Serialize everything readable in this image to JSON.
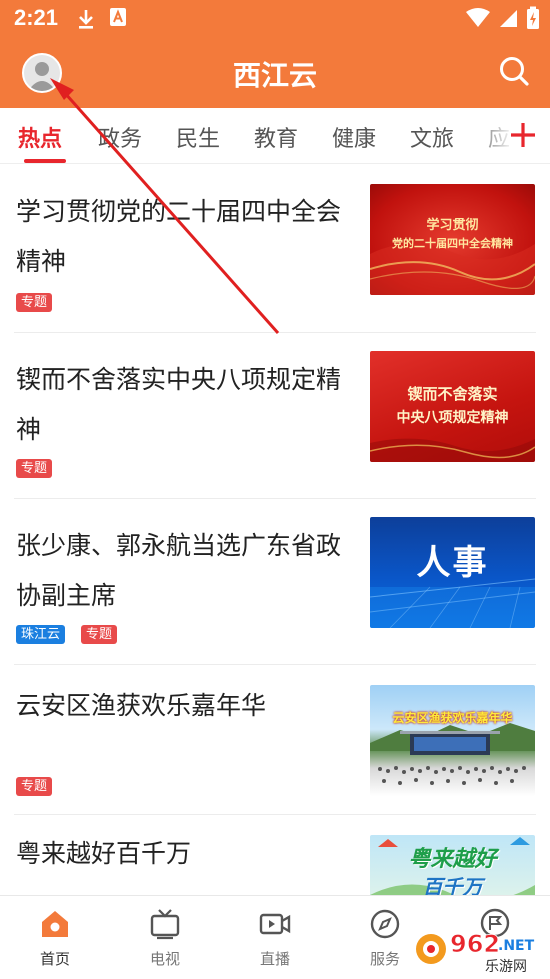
{
  "status_bar": {
    "time": "2:21",
    "icons": [
      "download-icon",
      "a-badge-icon",
      "wifi-icon",
      "signal-icon",
      "battery-charging-icon"
    ]
  },
  "header": {
    "title": "西江云",
    "background_color": "#f37a3b",
    "avatar_icon": "user-avatar-icon",
    "search_icon": "search-icon"
  },
  "tabs": {
    "items": [
      {
        "label": "热点",
        "active": true
      },
      {
        "label": "政务",
        "active": false
      },
      {
        "label": "民生",
        "active": false
      },
      {
        "label": "教育",
        "active": false
      },
      {
        "label": "健康",
        "active": false
      },
      {
        "label": "文旅",
        "active": false
      },
      {
        "label": "应",
        "active": false
      }
    ],
    "add_icon": "plus-icon",
    "active_color": "#e8262d"
  },
  "feed": {
    "items": [
      {
        "title": "学习贯彻党的二十届四中全会精神",
        "tags": [
          "专题"
        ],
        "thumb_text": [
          "学习贯彻",
          "党的二十届四中全会精神"
        ]
      },
      {
        "title": "锲而不舍落实中央八项规定精神",
        "tags": [
          "专题"
        ],
        "thumb_text": [
          "锲而不舍落实",
          "中央八项规定精神"
        ]
      },
      {
        "title": "张少康、郭永航当选广东省政协副主席",
        "tags": [
          "珠江云",
          "专题"
        ],
        "thumb_text": [
          "人事"
        ]
      },
      {
        "title": "云安区渔获欢乐嘉年华",
        "tags": [
          "专题"
        ],
        "thumb_text": [
          "云安区渔获欢乐嘉年华"
        ]
      },
      {
        "title": "粤来越好百千万",
        "tags": [],
        "thumb_text": [
          "粤来越好",
          "百千万"
        ]
      }
    ]
  },
  "bottom_nav": {
    "items": [
      {
        "label": "首页",
        "icon": "home-icon",
        "active": true
      },
      {
        "label": "电视",
        "icon": "tv-icon",
        "active": false
      },
      {
        "label": "直播",
        "icon": "live-video-icon",
        "active": false
      },
      {
        "label": "服务",
        "icon": "compass-icon",
        "active": false
      },
      {
        "label": "",
        "icon": "flag-chat-icon",
        "active": false
      }
    ]
  },
  "watermark": {
    "text": "962.NET",
    "subtext": "乐游网"
  }
}
